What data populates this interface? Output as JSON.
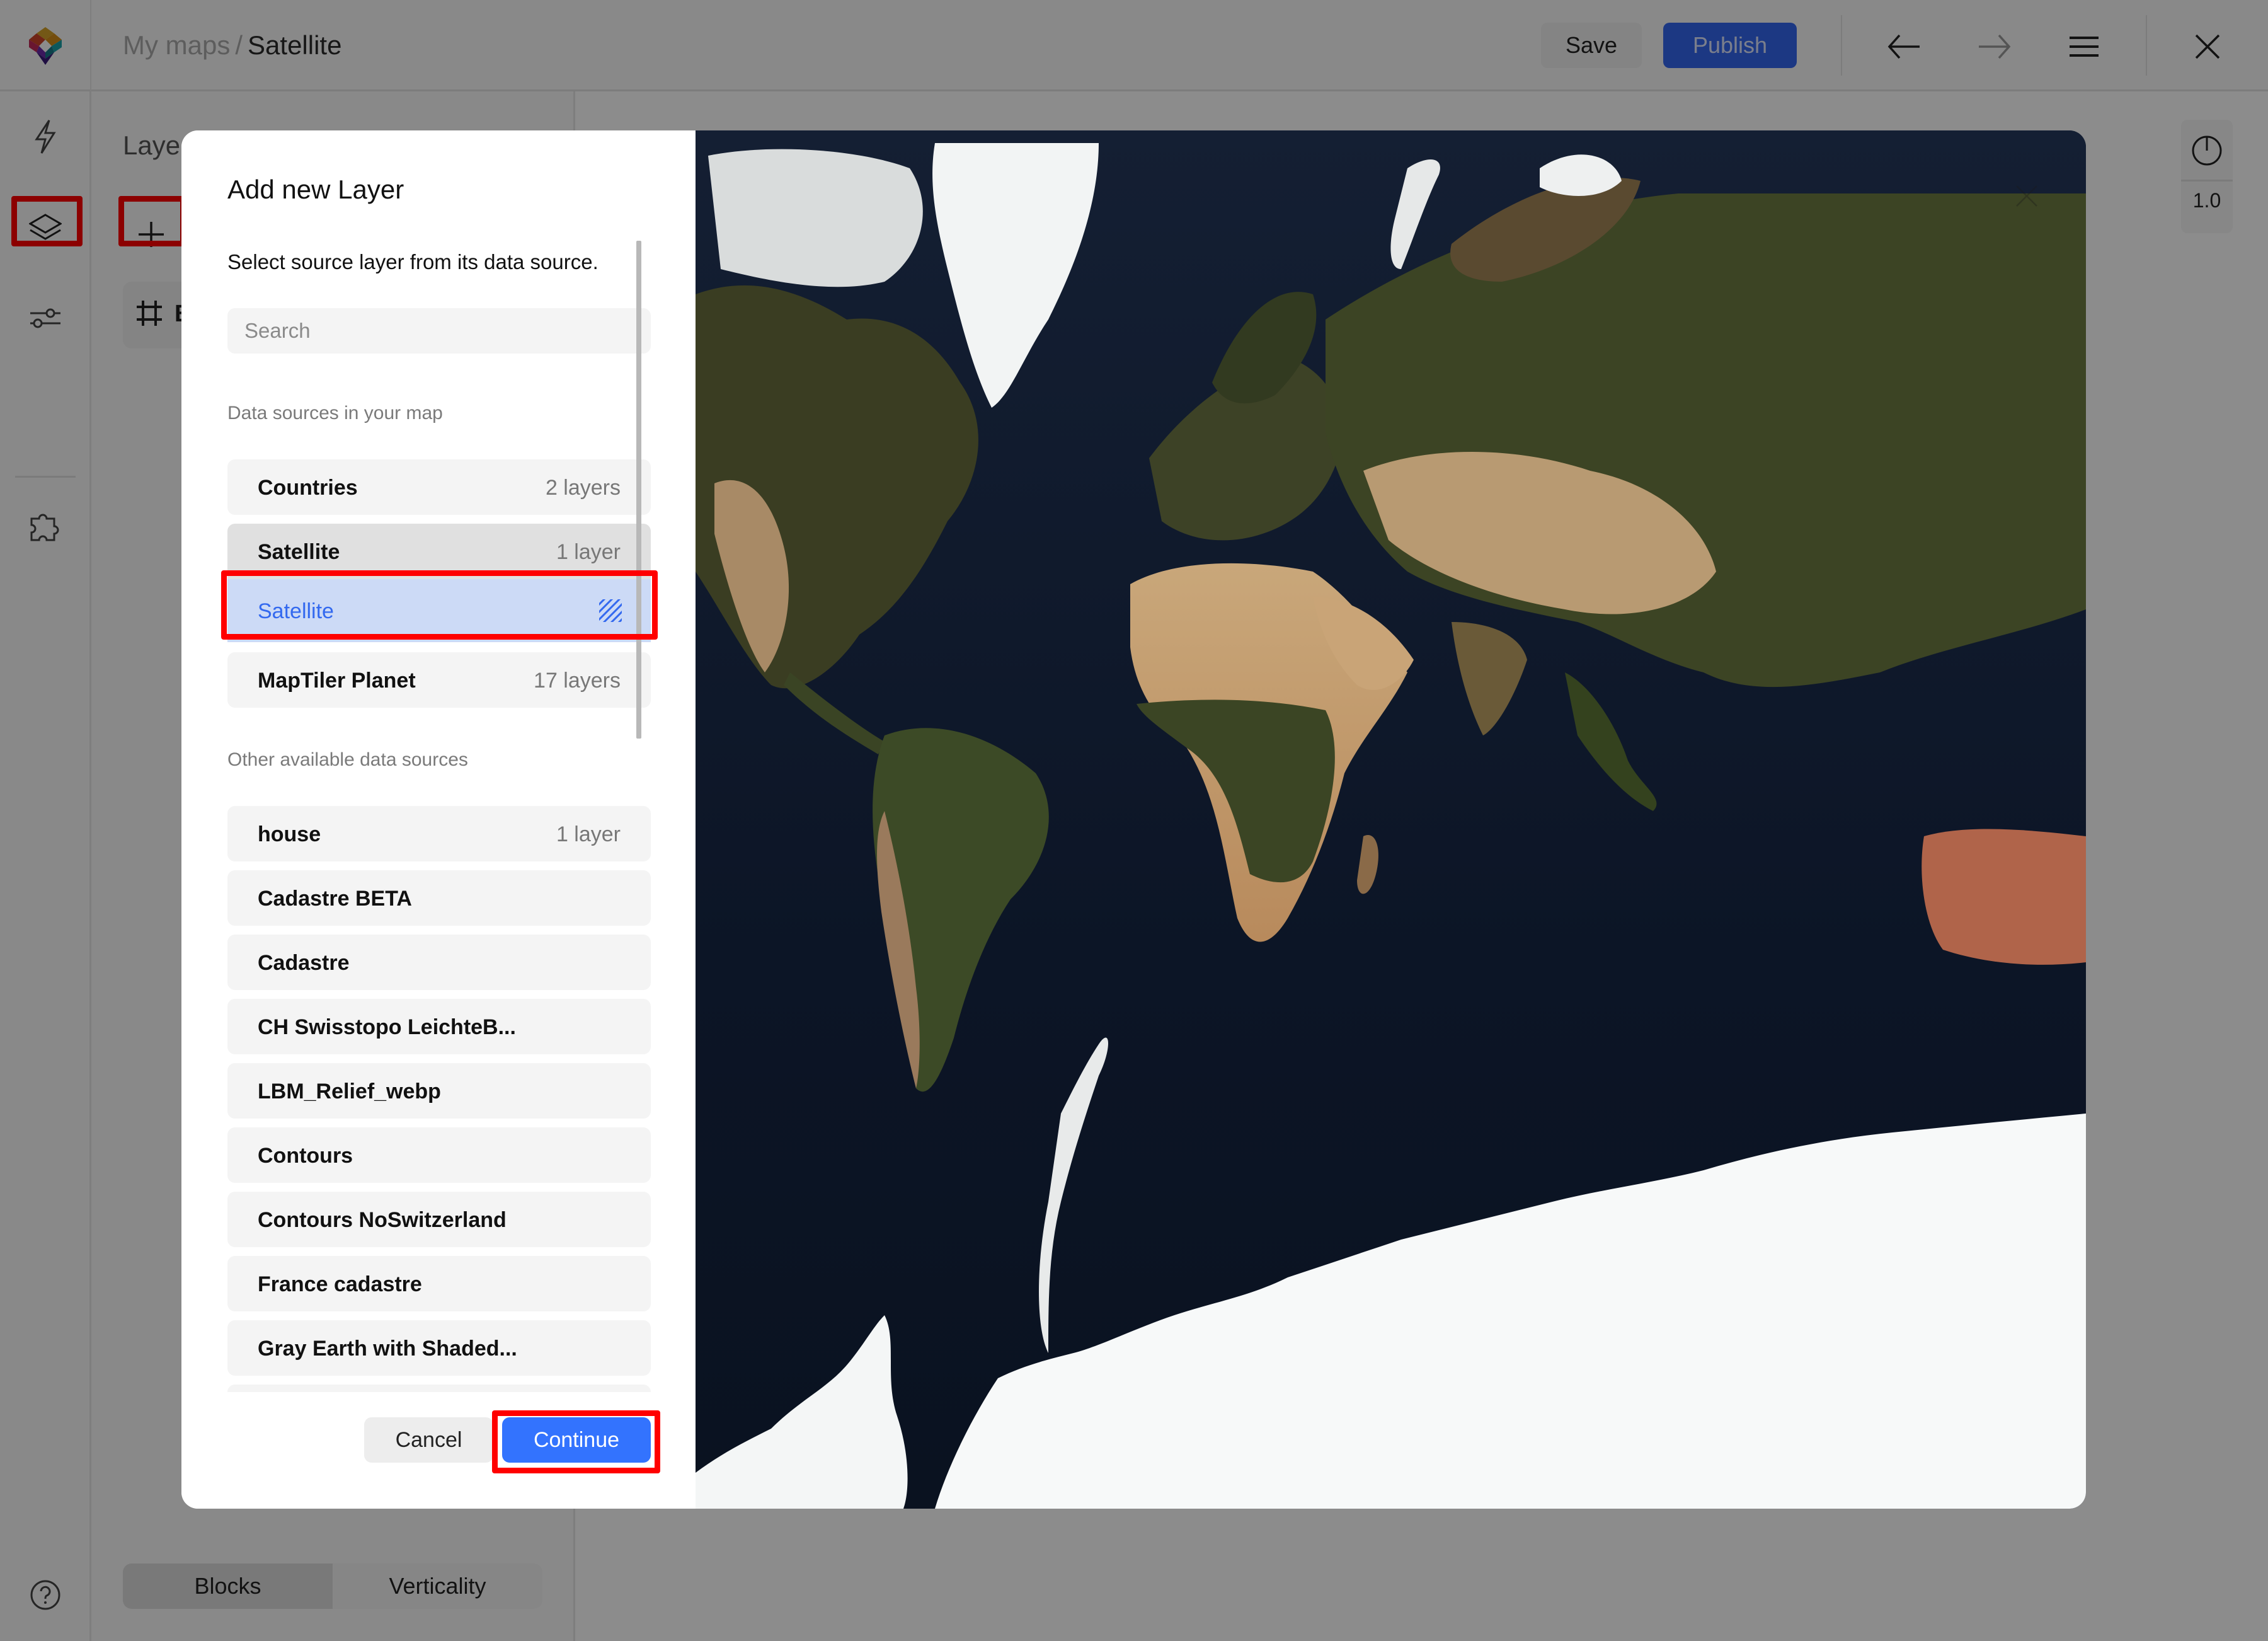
{
  "header": {
    "breadcrumb_parent": "My maps",
    "breadcrumb_separator": "/",
    "breadcrumb_current": "Satellite",
    "save_label": "Save",
    "publish_label": "Publish",
    "icons": [
      "logo-icon",
      "undo-arrow-icon",
      "redo-arrow-icon",
      "menu-icon",
      "close-icon"
    ]
  },
  "rail": {
    "items": [
      {
        "icon": "lightning-icon",
        "label": "Quick actions"
      },
      {
        "icon": "layers-icon",
        "label": "Layers",
        "active": true
      },
      {
        "icon": "sliders-icon",
        "label": "Settings"
      },
      {
        "icon": "puzzle-icon",
        "label": "Plugins"
      }
    ],
    "help_icon": "help-icon"
  },
  "panel": {
    "title": "Laye",
    "add_icon": "plus-icon",
    "layer_item": {
      "icon": "grid-icon",
      "label": "B"
    },
    "segments": [
      {
        "label": "Blocks",
        "active": true
      },
      {
        "label": "Verticality",
        "active": false
      }
    ]
  },
  "tools": {
    "compass_icon": "compass-icon",
    "zoom_value": "1.0"
  },
  "modal": {
    "title": "Add new Layer",
    "subtitle": "Select source layer from its data source.",
    "search": {
      "placeholder": "Search",
      "value": ""
    },
    "section_in_map": "Data sources in your map",
    "in_map_sources": [
      {
        "name": "Countries",
        "count": "2 layers"
      },
      {
        "name": "Satellite",
        "count": "1 layer",
        "expanded": true
      },
      {
        "name": "Satellite",
        "count": "",
        "selected": true,
        "icon": "raster-hatch-icon"
      },
      {
        "name": "MapTiler Planet",
        "count": "17 layers"
      }
    ],
    "section_other": "Other available data sources",
    "other_sources": [
      {
        "name": "house",
        "count": "1 layer"
      },
      {
        "name": "Cadastre BETA",
        "count": ""
      },
      {
        "name": "Cadastre",
        "count": ""
      },
      {
        "name": "CH Swisstopo LeichteB...",
        "count": ""
      },
      {
        "name": "LBM_Relief_webp",
        "count": ""
      },
      {
        "name": "Contours",
        "count": ""
      },
      {
        "name": "Contours NoSwitzerland",
        "count": ""
      },
      {
        "name": "France cadastre",
        "count": ""
      },
      {
        "name": "Gray Earth with Shaded...",
        "count": ""
      },
      {
        "name": "",
        "count": ""
      }
    ],
    "cancel_label": "Cancel",
    "continue_label": "Continue",
    "preview": {
      "type": "satellite-world-map",
      "close_icon": "close-icon"
    }
  },
  "colors": {
    "accent": "#3373fe",
    "selected_bg": "#ccdaf6",
    "selected_text": "#3369ef",
    "annotation_red": "#ff0000",
    "ocean": "#0c1424"
  }
}
